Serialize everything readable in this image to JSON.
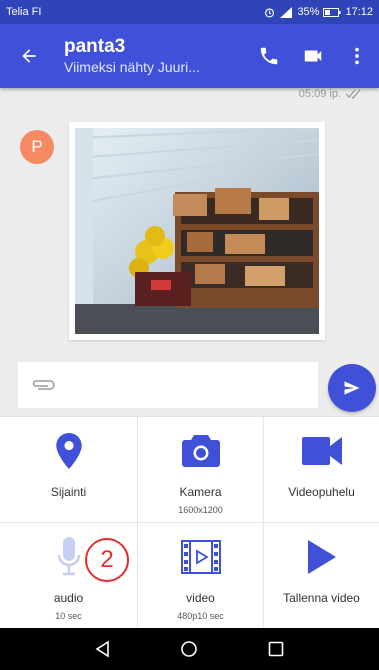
{
  "status": {
    "carrier": "Telia FI",
    "battery": "35%",
    "time": "17:12"
  },
  "header": {
    "title": "panta3",
    "subtitle": "Viimeksi nähty Juuri..."
  },
  "chat": {
    "timestamp": "05:09 ip.",
    "avatar_letter": "P"
  },
  "tiles": [
    {
      "label": "Sijainti",
      "sub": "",
      "icon": "location-pin-icon"
    },
    {
      "label": "Kamera",
      "sub": "1600x1200",
      "icon": "camera-icon"
    },
    {
      "label": "Videopuhelu",
      "sub": "",
      "icon": "video-camera-icon"
    },
    {
      "label": "audio",
      "sub": "10 sec",
      "icon": "microphone-icon"
    },
    {
      "label": "video",
      "sub": "480p10 sec",
      "icon": "film-icon"
    },
    {
      "label": "Tallenna video",
      "sub": "",
      "icon": "play-icon"
    }
  ],
  "annotation": {
    "badge": "2"
  },
  "colors": {
    "primary": "#3f51d8",
    "status_bar": "#2f44b8",
    "avatar": "#f58a64",
    "annotation": "#e23030"
  }
}
